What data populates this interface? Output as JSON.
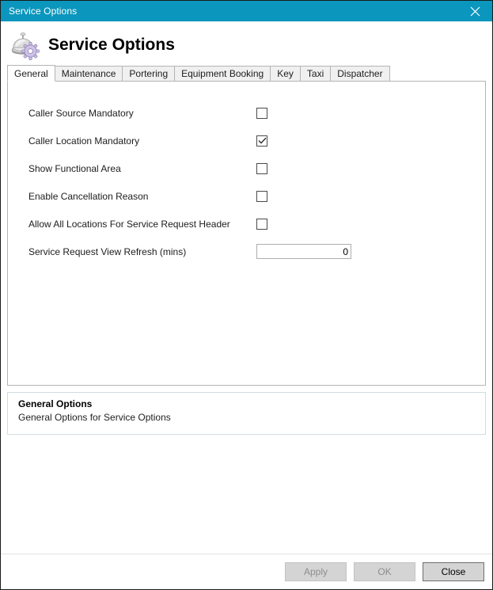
{
  "window": {
    "title": "Service Options",
    "close_icon": "close-icon"
  },
  "header": {
    "icon": "service-bell-gear-icon",
    "title": "Service Options"
  },
  "tabs": [
    {
      "label": "General",
      "selected": true
    },
    {
      "label": "Maintenance",
      "selected": false
    },
    {
      "label": "Portering",
      "selected": false
    },
    {
      "label": "Equipment Booking",
      "selected": false
    },
    {
      "label": "Key",
      "selected": false
    },
    {
      "label": "Taxi",
      "selected": false
    },
    {
      "label": "Dispatcher",
      "selected": false
    }
  ],
  "form": {
    "rows": [
      {
        "label": "Caller Source Mandatory",
        "type": "checkbox",
        "checked": false
      },
      {
        "label": "Caller Location Mandatory",
        "type": "checkbox",
        "checked": true
      },
      {
        "label": "Show Functional Area",
        "type": "checkbox",
        "checked": false
      },
      {
        "label": "Enable Cancellation Reason",
        "type": "checkbox",
        "checked": false
      },
      {
        "label": "Allow All Locations For Service Request Header",
        "type": "checkbox",
        "checked": false
      },
      {
        "label": "Service Request View Refresh (mins)",
        "type": "number",
        "value": "0",
        "placeholder": ""
      }
    ]
  },
  "description": {
    "title": "General Options",
    "text": "General Options for Service Options"
  },
  "footer": {
    "buttons": [
      {
        "label": "Apply",
        "enabled": false
      },
      {
        "label": "OK",
        "enabled": false
      },
      {
        "label": "Close",
        "enabled": true
      }
    ]
  },
  "colors": {
    "titlebar": "#0b96bd",
    "titlebar_text": "#ffffff",
    "panel_border": "#b4b4b4",
    "desc_border": "#cfdce4",
    "button_face": "#d4d4d4",
    "disabled_text": "#8d8d8d"
  }
}
